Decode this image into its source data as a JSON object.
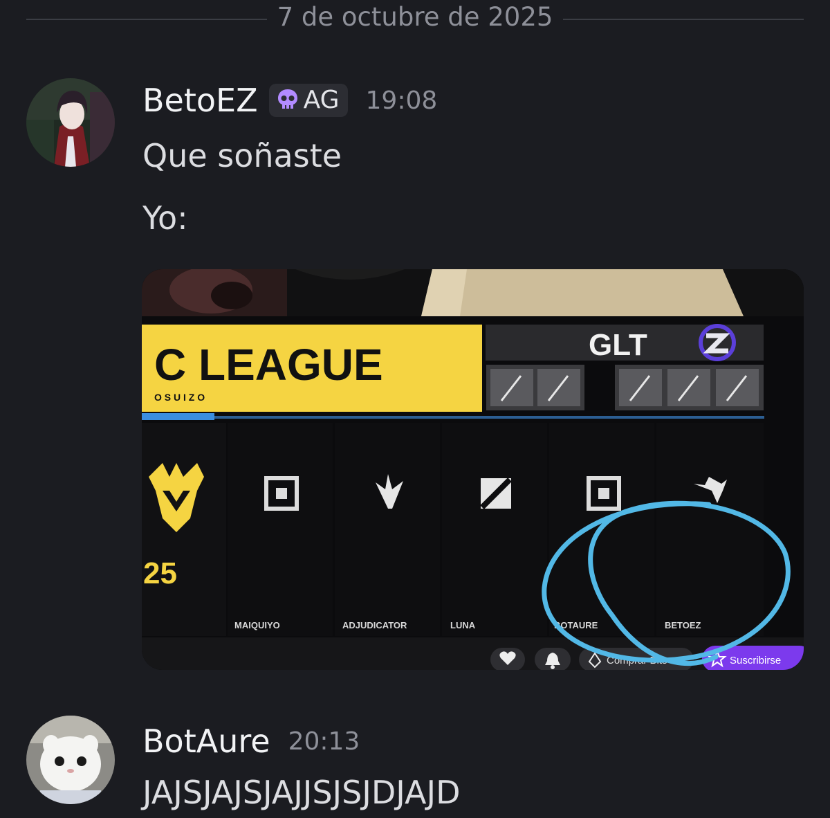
{
  "divider": {
    "date": "7 de octubre de 2025"
  },
  "messages": [
    {
      "username": "BetoEZ",
      "tag": {
        "icon": "skull-icon",
        "label": "AG",
        "color": "#b28bff"
      },
      "time": "19:08",
      "lines": [
        "Que soñaste",
        "Yo:"
      ],
      "attachment": {
        "league_text": "C LEAGUE",
        "league_sub": "O   S U I Z O",
        "glt_text": "GLT",
        "year_text": "25",
        "players": [
          "MAIQUIYO",
          "ADJUDICATOR",
          "LUNA",
          "BOTAURE",
          "BETOEZ"
        ],
        "stream_buttons": [
          "Comprar Bits",
          "Suscribirse"
        ]
      }
    },
    {
      "username": "BotAure",
      "time": "20:13",
      "lines": [
        "JAJSJAJSJAJJSJSJDJAJD"
      ]
    }
  ],
  "colors": {
    "background": "#1b1c21",
    "league_yellow": "#f5d442",
    "circle_blue": "#52b8e6",
    "subscribe_purple": "#7c3aed"
  }
}
